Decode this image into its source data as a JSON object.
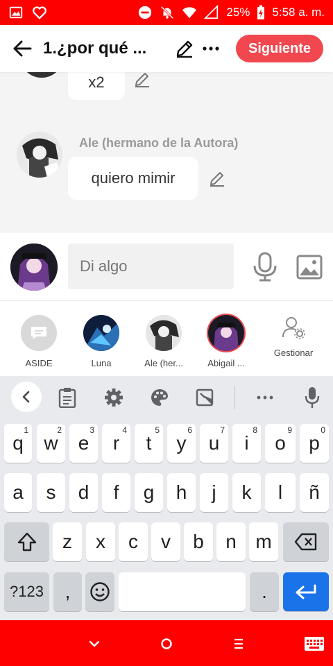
{
  "status_bar": {
    "battery": "25%",
    "time": "5:58 a. m.",
    "icons": [
      "gallery-icon",
      "heart-icon",
      "do-not-disturb-icon",
      "bell-muted-icon",
      "wifi-icon",
      "signal-icon",
      "battery-charging-icon"
    ]
  },
  "header": {
    "title": "1.¿por qué ...",
    "next_label": "Siguiente"
  },
  "chat": {
    "partial_message": "x2",
    "messages": [
      {
        "author": "Ale (hermano de la Autora)",
        "text": "quiero mimir"
      }
    ]
  },
  "composer": {
    "placeholder": "Di algo"
  },
  "characters": {
    "items": [
      {
        "label": "ASIDE"
      },
      {
        "label": "Luna"
      },
      {
        "label": "Ale (her..."
      },
      {
        "label": "Abigail ..."
      }
    ],
    "manage_label": "Gestionar"
  },
  "keyboard": {
    "row1": [
      {
        "key": "q",
        "hint": "1"
      },
      {
        "key": "w",
        "hint": "2"
      },
      {
        "key": "e",
        "hint": "3"
      },
      {
        "key": "r",
        "hint": "4"
      },
      {
        "key": "t",
        "hint": "5"
      },
      {
        "key": "y",
        "hint": "6"
      },
      {
        "key": "u",
        "hint": "7"
      },
      {
        "key": "i",
        "hint": "8"
      },
      {
        "key": "o",
        "hint": "9"
      },
      {
        "key": "p",
        "hint": "0"
      }
    ],
    "row2": [
      "a",
      "s",
      "d",
      "f",
      "g",
      "h",
      "j",
      "k",
      "l",
      "ñ"
    ],
    "row3": [
      "z",
      "x",
      "c",
      "v",
      "b",
      "n",
      "m"
    ],
    "symbols_label": "?123",
    "comma": ",",
    "period": "."
  },
  "colors": {
    "status_bar": "#ff0000",
    "accent": "#f2474f",
    "enter_key": "#1a73e8"
  }
}
